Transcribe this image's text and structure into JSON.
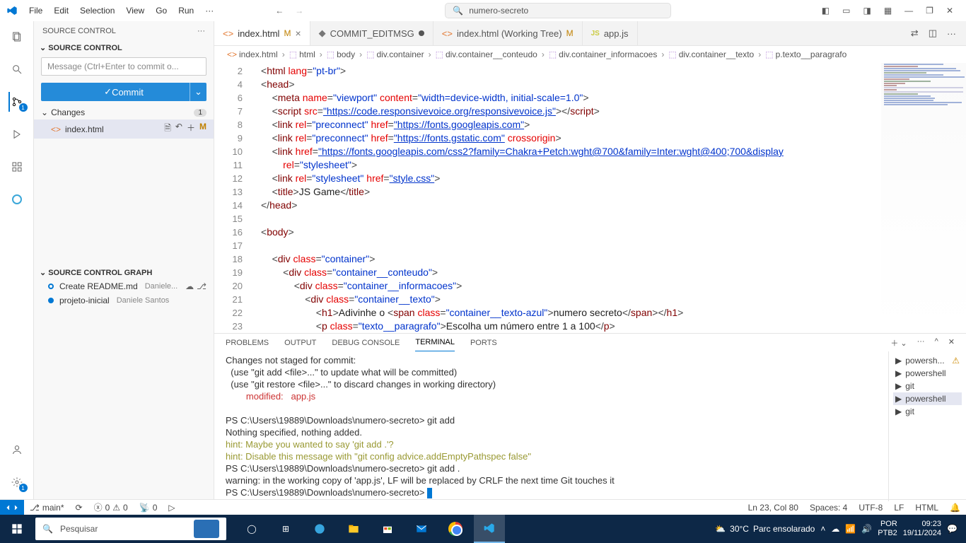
{
  "menu": {
    "items": [
      "File",
      "Edit",
      "Selection",
      "View",
      "Go",
      "Run"
    ]
  },
  "search": {
    "placeholder": "numero-secreto"
  },
  "sidebar": {
    "title": "SOURCE CONTROL",
    "section": "SOURCE CONTROL",
    "msg_placeholder": "Message (Ctrl+Enter to commit o...",
    "commit": "Commit",
    "changes": "Changes",
    "changes_count": "1",
    "file": "index.html",
    "file_status": "M",
    "graph_title": "SOURCE CONTROL GRAPH",
    "graph": [
      {
        "msg": "Create README.md",
        "author": "Daniele..."
      },
      {
        "msg": "projeto-inicial",
        "author": "Daniele Santos"
      }
    ]
  },
  "tabs": [
    {
      "icon": "<>",
      "name": "index.html",
      "badge": "M",
      "active": true,
      "close": true
    },
    {
      "icon": "◆",
      "name": "COMMIT_EDITMSG",
      "mod": true
    },
    {
      "icon": "<>",
      "name": "index.html (Working Tree)",
      "badge": "M"
    },
    {
      "icon": "JS",
      "name": "app.js"
    }
  ],
  "breadcrumb": [
    "index.html",
    "html",
    "body",
    "div.container",
    "div.container__conteudo",
    "div.container_informacoes",
    "div.container__texto",
    "p.texto__paragrafo"
  ],
  "code": {
    "lines": [
      2,
      4,
      6,
      7,
      8,
      9,
      10,
      11,
      12,
      13,
      14,
      15,
      16,
      17,
      18,
      19,
      20,
      21,
      22,
      23
    ]
  },
  "panel": {
    "tabs": [
      "PROBLEMS",
      "OUTPUT",
      "DEBUG CONSOLE",
      "TERMINAL",
      "PORTS"
    ],
    "active": "TERMINAL",
    "terminals": [
      {
        "name": "powersh...",
        "warn": true
      },
      {
        "name": "powershell"
      },
      {
        "name": "git"
      },
      {
        "name": "powershell",
        "active": true
      },
      {
        "name": "git"
      }
    ],
    "term": {
      "l1": "Changes not staged for commit:",
      "l2": "  (use \"git add <file>...\" to update what will be committed)",
      "l3": "  (use \"git restore <file>...\" to discard changes in working directory)",
      "l4": "        modified:   app.js",
      "l5": "PS C:\\Users\\19889\\Downloads\\numero-secreto> git add",
      "l6": "Nothing specified, nothing added.",
      "l7": "hint: Maybe you wanted to say 'git add .'?",
      "l8": "hint: Disable this message with \"git config advice.addEmptyPathspec false\"",
      "l9": "PS C:\\Users\\19889\\Downloads\\numero-secreto> git add .",
      "l10": "warning: in the working copy of 'app.js', LF will be replaced by CRLF the next time Git touches it",
      "l11": "PS C:\\Users\\19889\\Downloads\\numero-secreto> "
    }
  },
  "status": {
    "branch": "main*",
    "sync": "",
    "errors": "0",
    "warnings": "0",
    "port": "0",
    "ln": "Ln 23, Col 80",
    "spaces": "Spaces: 4",
    "enc": "UTF-8",
    "eol": "LF",
    "lang": "HTML"
  },
  "taskbar": {
    "search": "Pesquisar",
    "weather_temp": "30°C",
    "weather_desc": "Parc ensolarado",
    "lang1": "POR",
    "lang2": "PTB2",
    "time": "09:23",
    "date": "19/11/2024"
  }
}
